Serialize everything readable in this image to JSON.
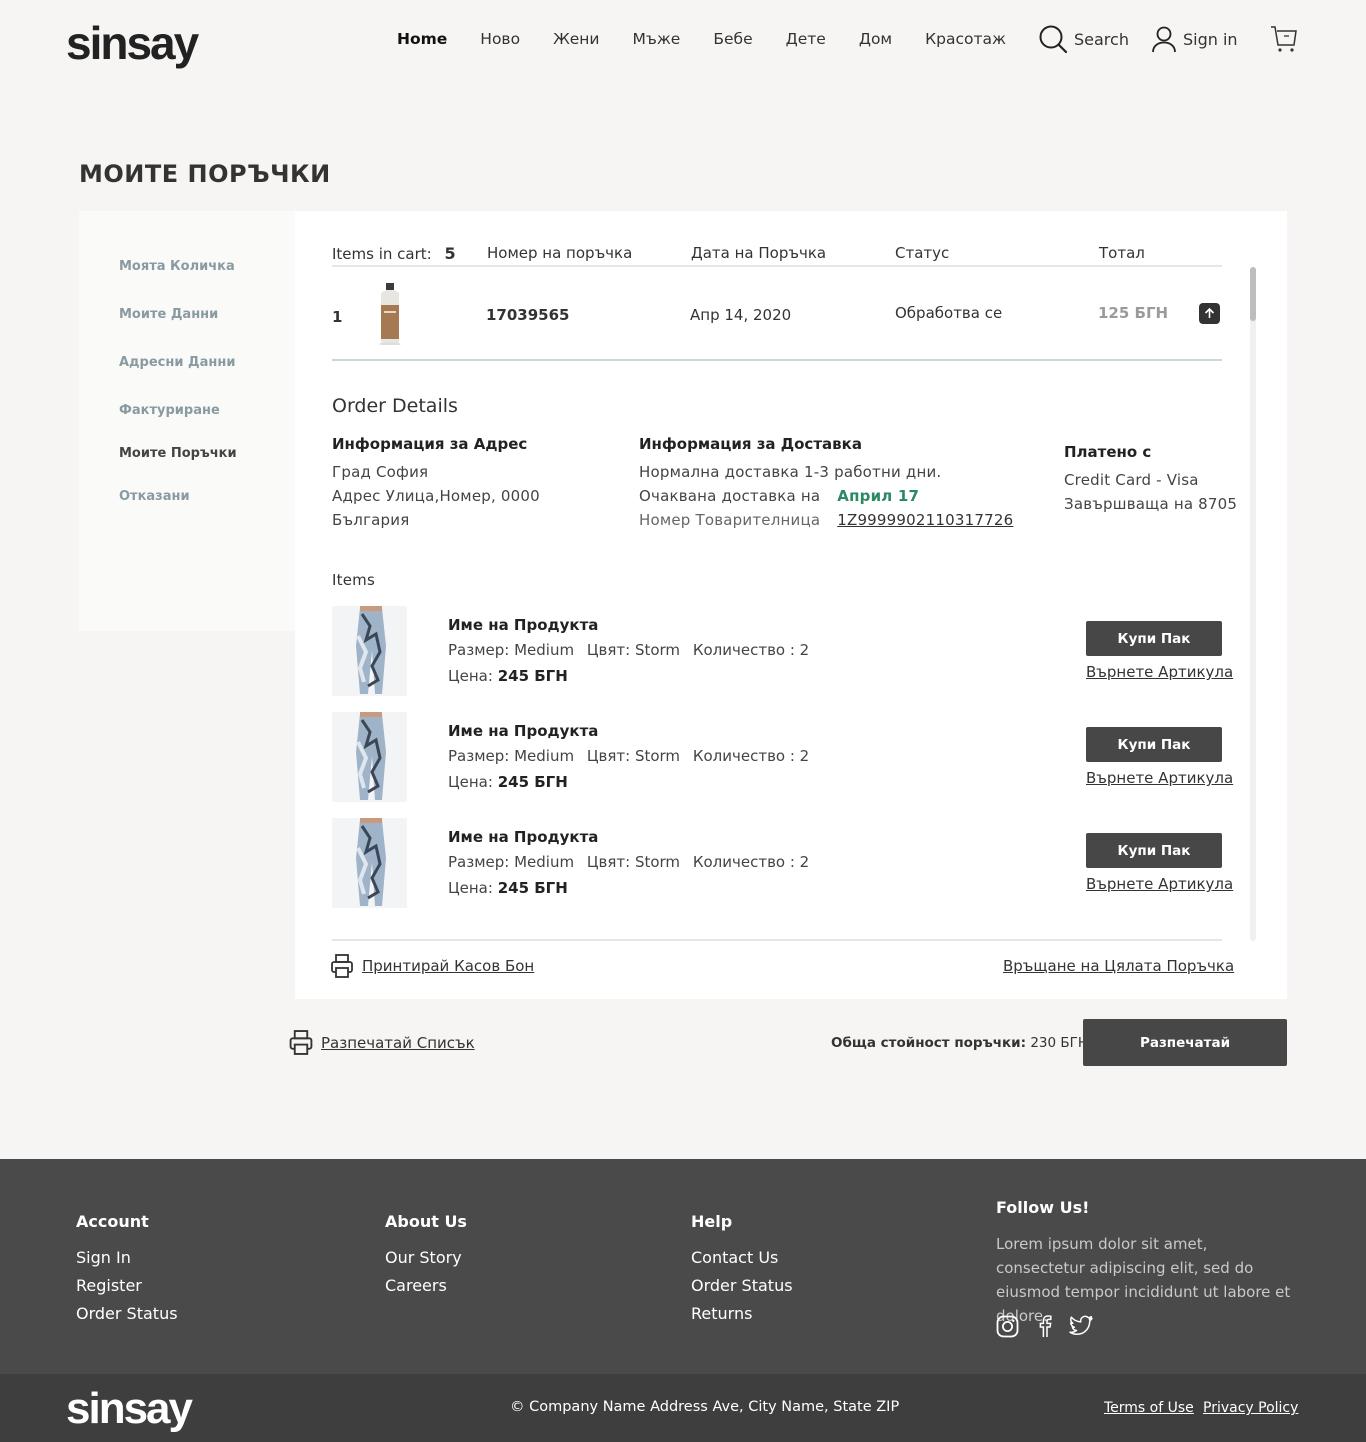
{
  "brand": {
    "logo": "sinsay"
  },
  "nav": {
    "items": [
      "Home",
      "Ново",
      "Жени",
      "Мъже",
      "Бебе",
      "Дете",
      "Дом",
      "Красотаж"
    ],
    "search_label": "Search",
    "signin_label": "Sign in"
  },
  "page": {
    "title": "МОИТЕ ПОРЪЧКИ"
  },
  "sidebar": {
    "items": [
      "Моята Количка",
      "Моите Данни",
      "Адресни Данни",
      "Фактуриране",
      "Моите Поръчки",
      "Отказани"
    ]
  },
  "table": {
    "items_in_cart_label": "Items in cart:",
    "items_in_cart_count": "5",
    "headers": [
      "Номер на поръчка",
      "Дата на Поръчка",
      "Статус",
      "Тотал"
    ],
    "row": {
      "index": "1",
      "order_number": "17039565",
      "date": "Апр 14, 2020",
      "status": "Обработва се",
      "total": "125 БГН"
    }
  },
  "details": {
    "title": "Order Details",
    "address_label": "Информация за Адрес",
    "address_lines": [
      "Град София",
      "Адрес Улица,Номер, 0000",
      "България"
    ],
    "delivery_label": "Информация за Доставка",
    "delivery_line1": "Нормална доставка 1-3 работни дни.",
    "expected_label": "Очаквана доставка на",
    "expected_date": "Април 17",
    "tracking_label": "Номер Товарителница",
    "tracking_number": "1Z9999902110317726",
    "paid_label": "Платено с",
    "paid_lines": [
      "Credit Card - Visa",
      "Завършваща на 8705"
    ]
  },
  "items": {
    "label": "Items",
    "list": [
      {
        "name": "Име на Продукта",
        "size": "Размер: Medium",
        "color": "Цвят: Storm",
        "qty": "Количество : 2",
        "price_label": "Цена:",
        "price": "245 БГН",
        "buy": "Купи Пак",
        "return": "Върнете Артикула"
      },
      {
        "name": "Име на Продукта",
        "size": "Размер: Medium",
        "color": "Цвят: Storm",
        "qty": "Количество : 2",
        "price_label": "Цена:",
        "price": "245 БГН",
        "buy": "Купи Пак",
        "return": "Върнете Артикула"
      },
      {
        "name": "Име на Продукта",
        "size": "Размер: Medium",
        "color": "Цвят: Storm",
        "qty": "Количество : 2",
        "price_label": "Цена:",
        "price": "245 БГН",
        "buy": "Купи Пак",
        "return": "Върнете Артикула"
      }
    ]
  },
  "panel_footer": {
    "print_receipt": "Принтирай Касов Бон",
    "return_all": "Връщане на Цялата Поръчка"
  },
  "summary": {
    "print_list": "Разпечатай Списък",
    "total_label": "Обща стойност поръчки:",
    "total_value": "230 БГН",
    "print_button": "Разпечатай"
  },
  "footer": {
    "account": {
      "title": "Account",
      "links": [
        "Sign In",
        "Register",
        "Order Status"
      ]
    },
    "about": {
      "title": "About Us",
      "links": [
        "Our Story",
        "Careers"
      ]
    },
    "help": {
      "title": "Help",
      "links": [
        "Contact Us",
        "Order Status",
        "Returns"
      ]
    },
    "follow": {
      "title": "Follow Us!",
      "text": "Lorem ipsum dolor sit amet, consectetur adipiscing elit, sed do eiusmod tempor incididunt ut labore et dolore."
    },
    "copyright": "© Company Name Address Ave, City Name, State ZIP",
    "terms": "Terms of Use",
    "privacy": "Privacy Policy"
  },
  "colors": {
    "accent_green": "#2b8a64",
    "dark_button": "#474747",
    "footer_bg": "#4a4a4a",
    "sidebar_text": "#8a9aa1"
  },
  "icons": [
    "search-icon",
    "user-icon",
    "cart-icon",
    "expand-icon",
    "printer-icon",
    "instagram-icon",
    "facebook-icon",
    "twitter-icon"
  ]
}
